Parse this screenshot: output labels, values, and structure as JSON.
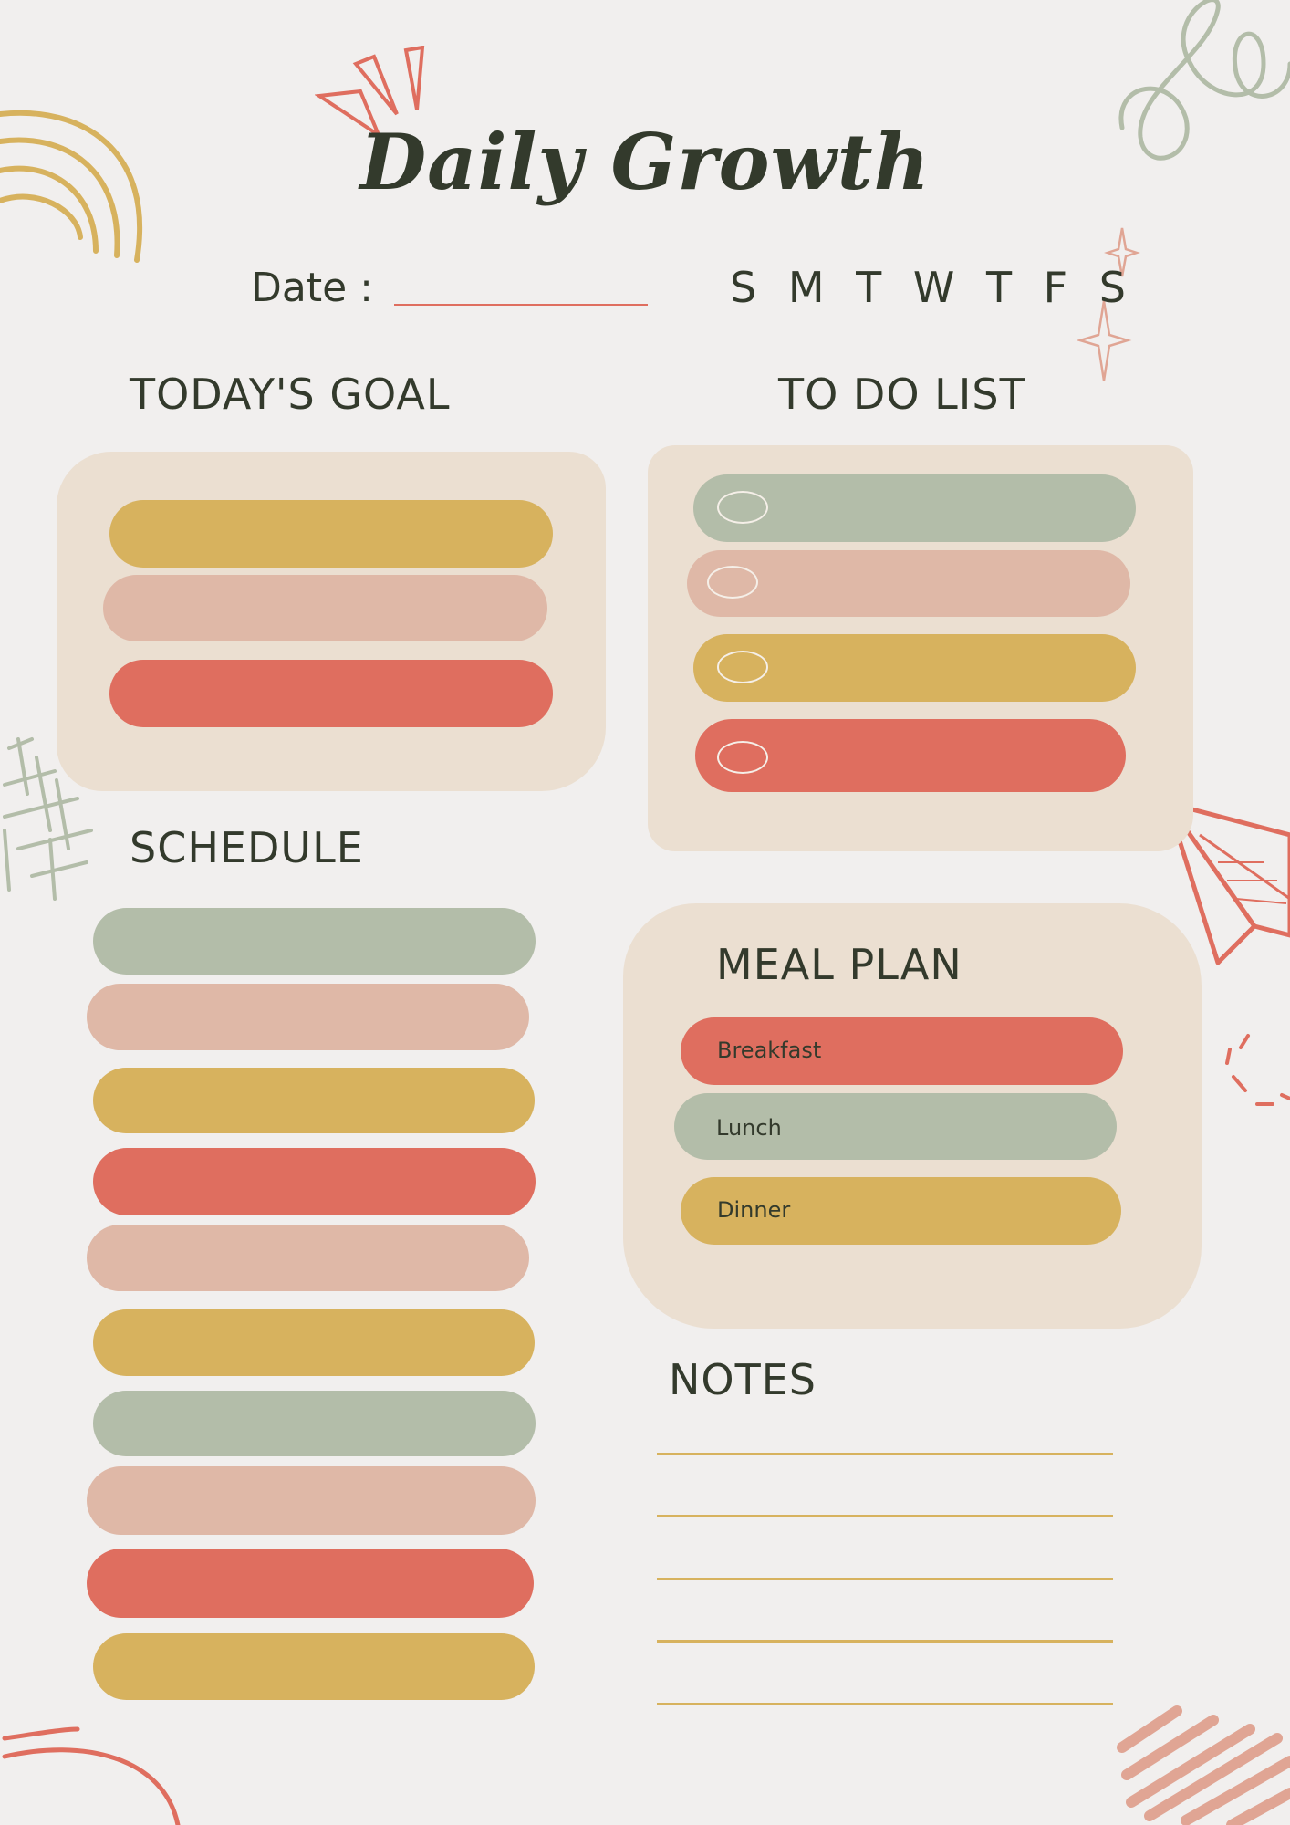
{
  "title": "Daily Growth",
  "date_label": "Date :",
  "week_days": "S M T W T F S",
  "sections": {
    "goal": "TODAY'S GOAL",
    "todo": "TO DO LIST",
    "schedule": "SCHEDULE",
    "meal": "MEAL PLAN",
    "notes": "NOTES"
  },
  "meals": [
    "Breakfast",
    "Lunch",
    "Dinner"
  ],
  "colors": {
    "background": "#f1efee",
    "panel": "#ebdfd1",
    "yellow": "#d7b25e",
    "pink": "#dfb8a7",
    "red": "#df6e5f",
    "green": "#b3bda9",
    "text": "#333a2c"
  },
  "decorations": [
    "rainbow-icon",
    "spark-lines-icon",
    "swirl-icon",
    "sparkle-icon",
    "grid-doodle-icon",
    "paper-plane-icon",
    "scribble-icon",
    "arc-icon"
  ]
}
